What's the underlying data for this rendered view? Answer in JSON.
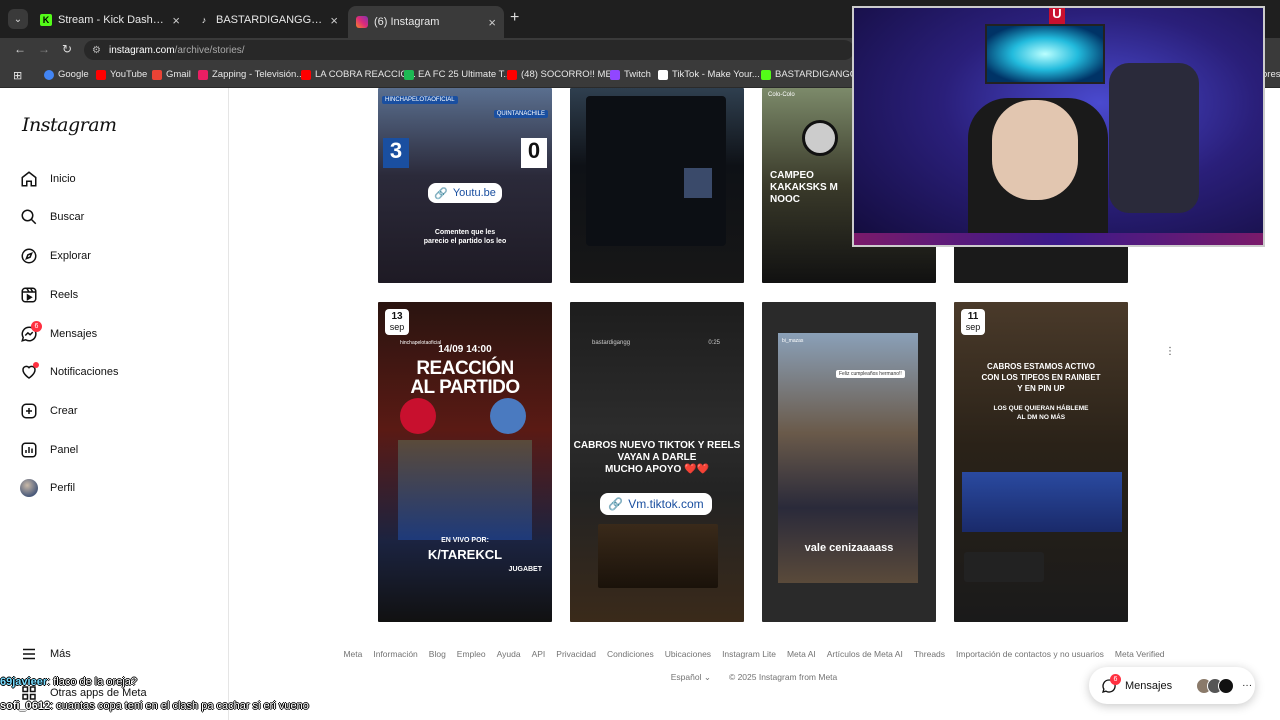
{
  "browser": {
    "tabs": [
      {
        "title": "Stream - Kick Dashboard",
        "icon": "kick-logo-icon",
        "color": "#53fc18"
      },
      {
        "title": "BASTARDIGANGGCLIPS (@bast",
        "icon": "tiktok-logo-icon",
        "color": "#ffffff"
      },
      {
        "title": "(6) Instagram",
        "icon": "instagram-logo-icon",
        "color": "#e1306c"
      }
    ],
    "url_host": "instagram.com",
    "url_path": "/archive/stories/",
    "bookmarks": [
      {
        "label": "Google",
        "color": "#4285f4"
      },
      {
        "label": "YouTube",
        "color": "#ff0000"
      },
      {
        "label": "Gmail",
        "color": "#ea4335"
      },
      {
        "label": "Zapping - Televisión...",
        "color": "#e91e63"
      },
      {
        "label": "LA COBRA REACCIO...",
        "color": "#ff0000"
      },
      {
        "label": "EA FC 25 Ultimate T...",
        "color": "#1db954"
      },
      {
        "label": "(48) SOCORRO!! ME...",
        "color": "#ff0000"
      },
      {
        "label": "Twitch",
        "color": "#9146ff"
      },
      {
        "label": "TikTok - Make Your...",
        "color": "#ffffff"
      },
      {
        "label": "BASTARDIGANGG |...",
        "color": "#53fc18"
      },
      {
        "label": "ores",
        "color": "#888888"
      }
    ]
  },
  "sidebar": {
    "logo": "Instagram",
    "items": [
      {
        "label": "Inicio",
        "icon": "home-icon"
      },
      {
        "label": "Buscar",
        "icon": "search-icon"
      },
      {
        "label": "Explorar",
        "icon": "compass-icon"
      },
      {
        "label": "Reels",
        "icon": "reels-icon"
      },
      {
        "label": "Mensajes",
        "icon": "messenger-icon",
        "badge": "6"
      },
      {
        "label": "Notificaciones",
        "icon": "heart-icon"
      },
      {
        "label": "Crear",
        "icon": "plus-square-icon"
      },
      {
        "label": "Panel",
        "icon": "chart-icon"
      },
      {
        "label": "Perfil",
        "icon": "avatar"
      }
    ],
    "more": "Más",
    "other_apps": "Otras apps de Meta"
  },
  "stories_top": [
    {
      "tag_left": "HINCHAPELOTAOFICIAL",
      "tag_right": "QUINTANACHILE",
      "score_left": "3",
      "score_right": "0",
      "link": "Youtu.be",
      "caption": "Comenten que les\nparecio el partido los leo"
    },
    {
      "caption": ""
    },
    {
      "tag": "Colo-Colo",
      "text": "CAMPEO\nKAKAKSKS M\nNOOC"
    },
    {
      "caption": ""
    }
  ],
  "stories_bottom": [
    {
      "day": "13",
      "month": "sep",
      "header": "hinchapelotaoficial",
      "time": "14/09 14:00",
      "title1": "REACCIÓN",
      "title2": "AL PARTIDO",
      "footer1": "EN VIVO POR:",
      "footer2": "K/TAREKCL",
      "sponsor": "JUGABET"
    },
    {
      "header": "bastardigangg",
      "duration": "0:25",
      "text": "CABROS NUEVO TIKTOK Y REELS\nVAYAN A DARLE\nMUCHO APOYO ❤️❤️",
      "link": "Vm.tiktok.com"
    },
    {
      "header": "bi_mazas",
      "sticker": "Feliz cumpleaños hermano!!",
      "caption": "vale cenizaaaass"
    },
    {
      "day": "11",
      "month": "sep",
      "text": "CABROS ESTAMOS ACTIVO\nCON LOS TIPEOS EN RAINBET\nY EN PIN UP",
      "sub": "LOS QUE QUIERAN HÁBLEME\nAL DM NO MÁS"
    }
  ],
  "footer_links": [
    "Meta",
    "Información",
    "Blog",
    "Empleo",
    "Ayuda",
    "API",
    "Privacidad",
    "Condiciones",
    "Ubicaciones",
    "Instagram Lite",
    "Meta AI",
    "Artículos de Meta AI",
    "Threads",
    "Importación de contactos y no usuarios",
    "Meta Verified"
  ],
  "footer_language": "Español",
  "footer_copyright": "© 2025 Instagram from Meta",
  "messages_pill": {
    "label": "Mensajes",
    "badge": "6",
    "more": "···"
  },
  "chat_overlay": [
    {
      "user": "69javieer",
      "message": ": flaco de la oreja?"
    },
    {
      "user": "sofi_0612",
      "message": ": cuantas copa teni en el clash pa cachar si eri vueno"
    }
  ],
  "colors": {
    "accent_red": "#ff3040",
    "link_blue": "#1a4fa0"
  }
}
